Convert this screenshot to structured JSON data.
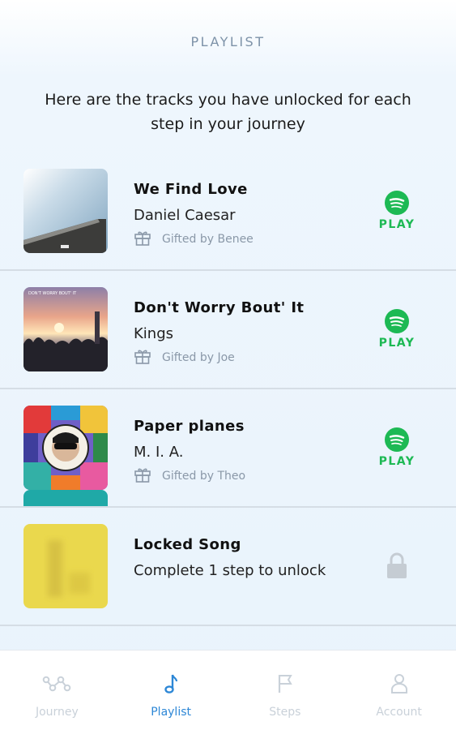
{
  "header": {
    "title": "PLAYLIST"
  },
  "intro": "Here are the tracks you have unlocked for each step in your journey",
  "tracks": [
    {
      "title": "We Find Love",
      "artist": "Daniel Caesar",
      "gifted": "Gifted by Benee",
      "action": "PLAY",
      "action_icon": "spotify-icon"
    },
    {
      "title": "Don't Worry Bout' It",
      "artist": "Kings",
      "gifted": "Gifted by Joe",
      "action": "PLAY",
      "action_icon": "spotify-icon"
    },
    {
      "title": "Paper planes",
      "artist": "M. I. A.",
      "gifted": "Gifted by Theo",
      "action": "PLAY",
      "action_icon": "spotify-icon"
    },
    {
      "title": "Locked Song",
      "subtitle": "Complete 1 step to unlock",
      "action_icon": "lock-icon"
    }
  ],
  "tabs": [
    {
      "label": "Journey",
      "icon": "journey-icon",
      "active": false
    },
    {
      "label": "Playlist",
      "icon": "music-note-icon",
      "active": true
    },
    {
      "label": "Steps",
      "icon": "flag-icon",
      "active": false
    },
    {
      "label": "Account",
      "icon": "person-icon",
      "active": false
    }
  ],
  "colors": {
    "spotify_green": "#1db954",
    "active_tab": "#2d87d6",
    "inactive_tab": "#c9d1d9",
    "locked_art": "#ead84d"
  }
}
